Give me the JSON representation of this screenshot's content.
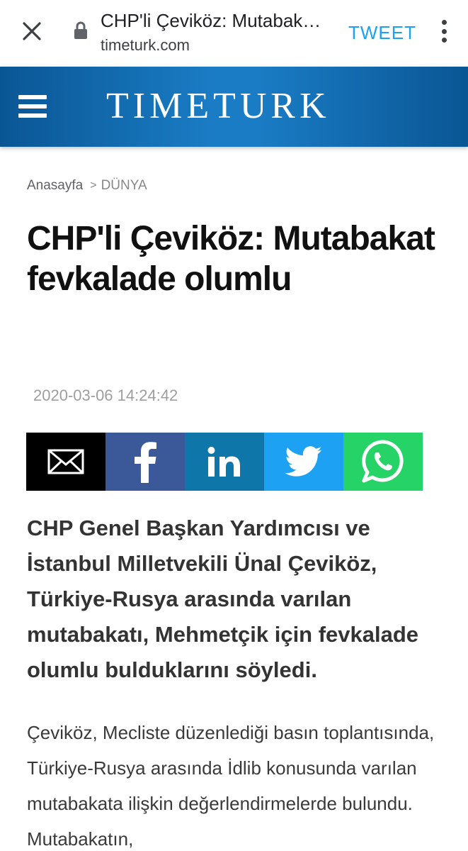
{
  "browser": {
    "title": "CHP'li Çeviköz: Mutabakat fevkalade olumlu",
    "domain": "timeturk.com",
    "tweet_label": "TWEET"
  },
  "site": {
    "logo": "TIMETURK"
  },
  "breadcrumb": {
    "home": "Anasayfa",
    "separator": ">",
    "section": "DÜNYA"
  },
  "article": {
    "headline": "CHP'li Çeviköz: Mutabakat fevkalade olumlu",
    "date": "2020-03-06 14:24:42",
    "lead": "CHP Genel Başkan Yardımcısı ve İstanbul Milletvekili Ünal Çeviköz, Türkiye-Rusya arasında varılan mutabakatı, Mehmetçik için fevkalade olumlu bulduklarını söyledi.",
    "body": "Çeviköz, Mecliste düzenlediği basın toplantısında, Türkiye-Rusya arasında İdlib konusunda varılan mutabakata ilişkin değerlendirmelerde bulundu. Mutabakatın,"
  },
  "share": {
    "buttons": [
      "email-icon",
      "facebook-icon",
      "linkedin-icon",
      "twitter-icon",
      "whatsapp-icon"
    ],
    "colors": {
      "email": "#000000",
      "facebook": "#3b5998",
      "linkedin": "#0e76a8",
      "twitter": "#1da1f2",
      "whatsapp": "#25d366"
    }
  },
  "colors": {
    "header": "#1a7cc4",
    "tweet": "#1da1f2"
  }
}
